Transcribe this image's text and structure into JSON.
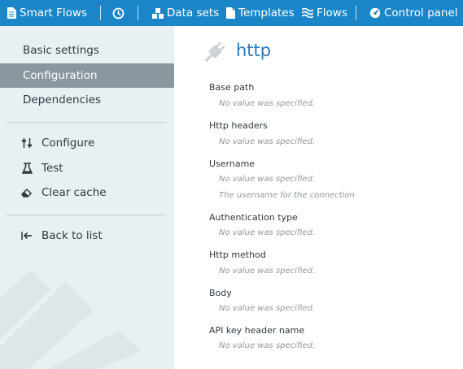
{
  "topbar": {
    "items": [
      {
        "label": "Smart Flows",
        "icon": "document-icon"
      },
      {
        "label": "",
        "icon": "clock-icon"
      },
      {
        "label": "Data sets",
        "icon": "blocks-icon"
      },
      {
        "label": "Templates",
        "icon": "file-icon"
      },
      {
        "label": "Flows",
        "icon": "waves-icon"
      },
      {
        "label": "Control panel",
        "icon": "gauge-icon"
      }
    ]
  },
  "sidebar": {
    "sections": [
      {
        "label": "Basic settings",
        "active": false
      },
      {
        "label": "Configuration",
        "active": true
      },
      {
        "label": "Dependencies",
        "active": false
      }
    ],
    "actions": [
      {
        "label": "Configure",
        "icon": "sliders-icon"
      },
      {
        "label": "Test",
        "icon": "flask-icon"
      },
      {
        "label": "Clear cache",
        "icon": "eraser-icon"
      }
    ],
    "back": {
      "label": "Back to list",
      "icon": "back-arrow-icon"
    }
  },
  "main": {
    "title": "http",
    "title_icon": "plug-icon",
    "fields": [
      {
        "label": "Base path",
        "value": "No value was specified."
      },
      {
        "label": "Http headers",
        "value": "No value was specified."
      },
      {
        "label": "Username",
        "value": "No value was specified.",
        "hint": "The username for the connection"
      },
      {
        "label": "Authentication type",
        "value": "No value was specified."
      },
      {
        "label": "Http method",
        "value": "No value was specified."
      },
      {
        "label": "Body",
        "value": "No value was specified."
      },
      {
        "label": "API key header name",
        "value": "No value was specified."
      }
    ]
  },
  "colors": {
    "topbar": "#1a86c7",
    "sidebar": "#e9f0f1",
    "active_item": "#8b979e",
    "title": "#2b7ab5"
  }
}
